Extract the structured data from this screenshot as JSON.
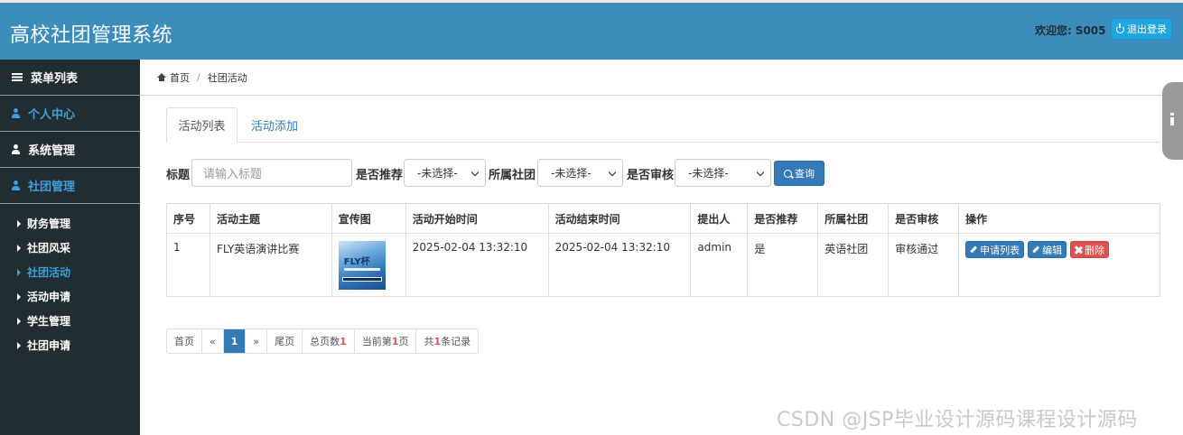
{
  "header": {
    "title": "高校社团管理系统",
    "welcome_label": "欢迎您:",
    "username": "S005",
    "logout_label": "退出登录"
  },
  "sidebar": {
    "menu_title": "菜单列表",
    "groups": [
      {
        "label": "个人中心"
      },
      {
        "label": "系统管理"
      },
      {
        "label": "社团管理"
      }
    ],
    "sub_items": [
      {
        "label": "财务管理"
      },
      {
        "label": "社团风采"
      },
      {
        "label": "社团活动"
      },
      {
        "label": "活动申请"
      },
      {
        "label": "学生管理"
      },
      {
        "label": "社团申请"
      }
    ]
  },
  "breadcrumb": {
    "home": "首页",
    "separator": "/",
    "current": "社团活动"
  },
  "tabs": [
    {
      "label": "活动列表"
    },
    {
      "label": "活动添加"
    }
  ],
  "search": {
    "title_label": "标题",
    "title_placeholder": "请输入标题",
    "recommend_label": "是否推荐",
    "recommend_value": "-未选择-",
    "club_label": "所属社团",
    "club_value": "-未选择-",
    "review_label": "是否审核",
    "review_value": "-未选择-",
    "query_label": "查询"
  },
  "table": {
    "headers": [
      "序号",
      "活动主题",
      "宣传图",
      "活动开始时间",
      "活动结束时间",
      "提出人",
      "是否推荐",
      "所属社团",
      "是否审核",
      "操作"
    ],
    "rows": [
      {
        "index": "1",
        "topic": "FLY英语演讲比赛",
        "poster_text": "FLY杯",
        "start": "2025-02-04 13:32:10",
        "end": "2025-02-04 13:32:10",
        "proposer": "admin",
        "recommend": "是",
        "club": "英语社团",
        "review": "审核通过",
        "actions": {
          "apply_list": "申请列表",
          "edit": "编辑",
          "delete": "删除"
        }
      }
    ]
  },
  "pagination": {
    "first": "首页",
    "prev": "«",
    "current": "1",
    "next": "»",
    "last": "尾页",
    "total_pages_prefix": "总页数",
    "total_pages": "1",
    "current_page_prefix": "当前第",
    "current_page": "1",
    "current_page_suffix": "页",
    "total_records_prefix": "共",
    "total_records": "1",
    "total_records_suffix": "条记录"
  },
  "watermark": "CSDN @JSP毕业设计源码课程设计源码",
  "colors": {
    "header_bg": "#3c8dbc",
    "sidebar_bg": "#222d32",
    "accent_blue": "#337ab7",
    "danger_red": "#d9534f",
    "success_green": "#008a00"
  }
}
